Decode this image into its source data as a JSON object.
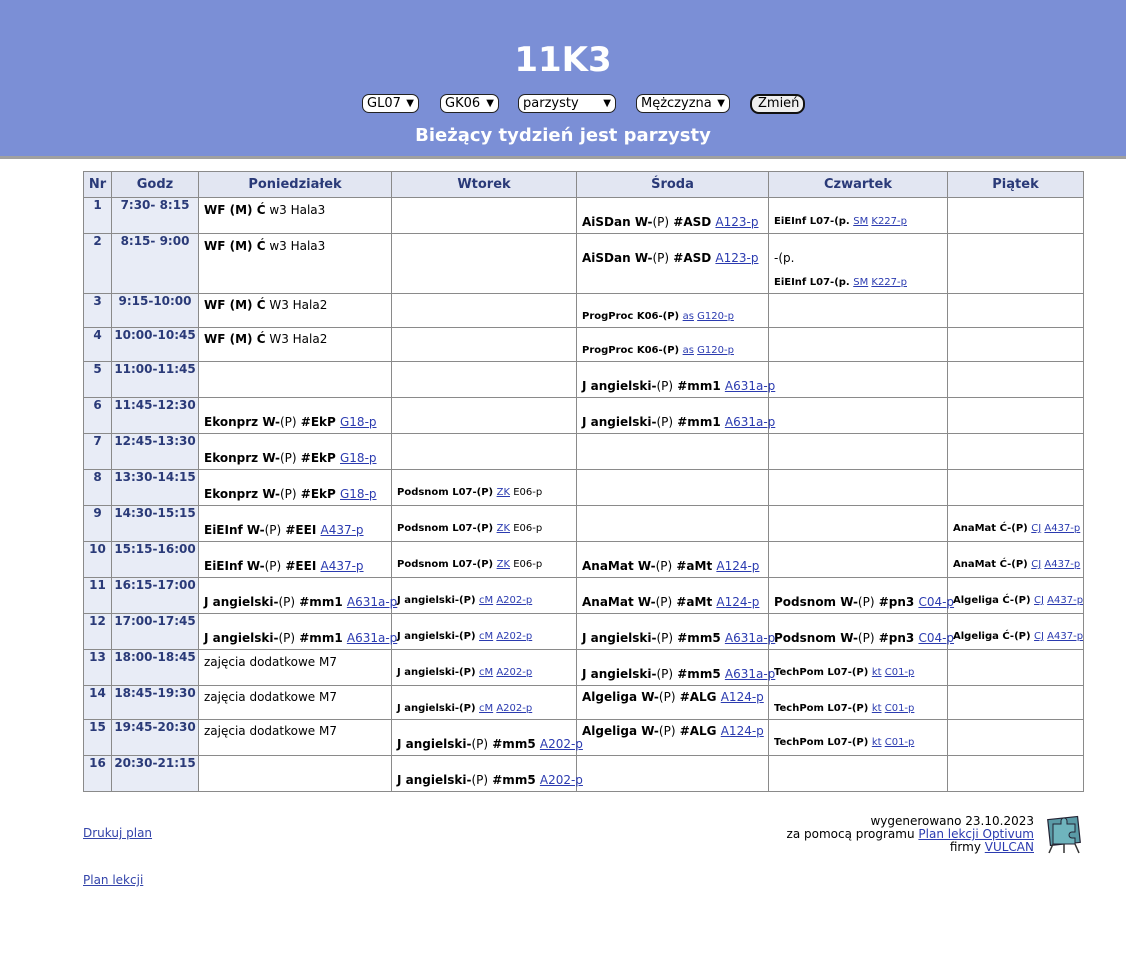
{
  "header": {
    "title": "11K3",
    "selects": [
      "GL07",
      "GK06",
      "parzysty",
      "Mężczyzna"
    ],
    "button": "Zmień",
    "week_info": "Bieżący tydzień jest parzysty"
  },
  "table": {
    "columns": [
      "Nr",
      "Godz",
      "Poniedziałek",
      "Wtorek",
      "Środa",
      "Czwartek",
      "Piątek"
    ],
    "rows": [
      {
        "nr": "1",
        "godz": "7:30- 8:15"
      },
      {
        "nr": "2",
        "godz": "8:15- 9:00"
      },
      {
        "nr": "3",
        "godz": "9:15-10:00"
      },
      {
        "nr": "4",
        "godz": "10:00-10:45"
      },
      {
        "nr": "5",
        "godz": "11:00-11:45"
      },
      {
        "nr": "6",
        "godz": "11:45-12:30"
      },
      {
        "nr": "7",
        "godz": "12:45-13:30"
      },
      {
        "nr": "8",
        "godz": "13:30-14:15"
      },
      {
        "nr": "9",
        "godz": "14:30-15:15"
      },
      {
        "nr": "10",
        "godz": "15:15-16:00"
      },
      {
        "nr": "11",
        "godz": "16:15-17:00"
      },
      {
        "nr": "12",
        "godz": "17:00-17:45"
      },
      {
        "nr": "13",
        "godz": "18:00-18:45"
      },
      {
        "nr": "14",
        "godz": "18:45-19:30"
      },
      {
        "nr": "15",
        "godz": "19:45-20:30"
      },
      {
        "nr": "16",
        "godz": "20:30-21:15"
      }
    ],
    "entries": {
      "wf_hala3": {
        "subject": "WF (M) Ć",
        "rest": " w3 Hala3"
      },
      "wf_hala2": {
        "subject": "WF (M) Ć",
        "rest": " W3 Hala2"
      },
      "aisdan": {
        "s1": "AiSDan W-",
        "s2": "(P)",
        "s3": " #ASD ",
        "room": "A123-p"
      },
      "eieinf_l07": {
        "s1": "EiEInf L07-(p. ",
        "t": "SM",
        "room": "K227-p"
      },
      "minus_p": {
        "text": "-(p."
      },
      "progproc": {
        "s1": "ProgProc K06-(P) ",
        "t": "as",
        "room": "G120-p"
      },
      "jang_mm1": {
        "s1": "J angielski-",
        "s2": "(P)",
        "s3": " #mm1 ",
        "room": "A631a-p"
      },
      "jang_mm5": {
        "s1": "J angielski-",
        "s2": "(P)",
        "s3": " #mm5 ",
        "room": "A631a-p"
      },
      "jang_mm5_a202": {
        "s1": "J angielski-",
        "s2": "(P)",
        "s3": " #mm5 ",
        "room": "A202-p"
      },
      "ekonprz": {
        "s1": "Ekonprz W-",
        "s2": "(P)",
        "s3": " #EkP ",
        "room": "G18-p"
      },
      "podsnom_l07": {
        "s1": "Podsnom L07-(P) ",
        "t": "ZK",
        "rest": " E06-p"
      },
      "eieinf_w": {
        "s1": "EiEInf W-",
        "s2": "(P)",
        "s3": " #EEI ",
        "room": "A437-p"
      },
      "anamat_c": {
        "s1": "AnaMat Ć-(P) ",
        "t": "CJ",
        "room": "A437-p"
      },
      "anamat_w": {
        "s1": "AnaMat W-",
        "s2": "(P)",
        "s3": " #aMt ",
        "room": "A124-p"
      },
      "jang_cm": {
        "s1": "J angielski-(P) ",
        "t": "cM",
        "room": "A202-p"
      },
      "podsnom_w": {
        "s1": "Podsnom W-",
        "s2": "(P)",
        "s3": " #pn3 ",
        "room": "C04-p"
      },
      "algeliga_c": {
        "s1": "Algeliga Ć-(P) ",
        "t": "CJ",
        "room": "A437-p"
      },
      "zajecia": {
        "text": "zajęcia dodatkowe M7"
      },
      "techpom": {
        "s1": "TechPom L07-(P) ",
        "t": "kt",
        "room": "C01-p"
      },
      "algeliga_w": {
        "s1": "Algeliga W-",
        "s2": "(P)",
        "s3": " #ALG ",
        "room": "A124-p"
      }
    }
  },
  "footer": {
    "print_link": "Drukuj plan",
    "plan_link": "Plan lekcji",
    "generated": "wygenerowano 23.10.2023",
    "via_prefix": "za pomocą programu ",
    "program_link": "Plan lekcji Optivum",
    "company_prefix": "firmy ",
    "company_link": "VULCAN",
    "colors": {
      "header_bg": "#7b8fd6",
      "table_header_bg": "#e2e6f2",
      "link": "#2b3bb0"
    }
  }
}
